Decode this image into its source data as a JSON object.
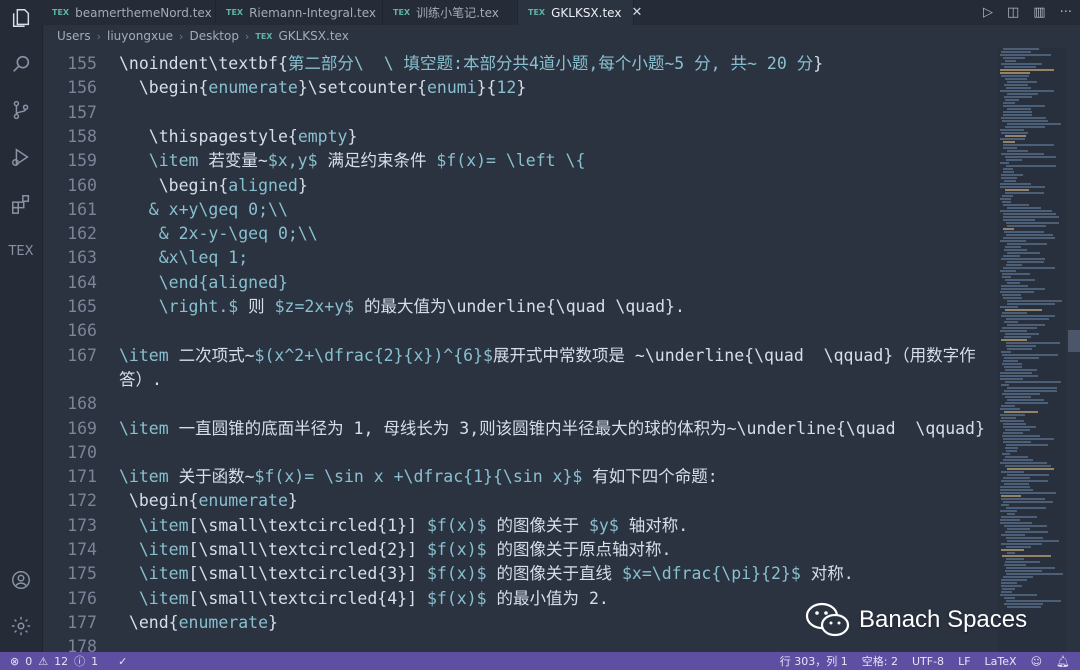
{
  "tabs": [
    {
      "label": "beamerthemeNord.tex",
      "active": false
    },
    {
      "label": "Riemann-Integral.tex",
      "active": false
    },
    {
      "label": "训练小笔记.tex",
      "active": false
    },
    {
      "label": "GKLKSX.tex",
      "active": true
    }
  ],
  "tex_badge": "TEX",
  "activity_tex_label": "TEX",
  "breadcrumb": [
    "Users",
    "liuyongxue",
    "Desktop",
    "GKLKSX.tex"
  ],
  "lines": [
    {
      "num": "155",
      "parts": [
        [
          "\\noindent\\textbf{",
          "cn"
        ],
        [
          "第二部分\\  \\ 填空题:本部分共4道小题,每个小题~5 分, 共~ 20 分",
          "kw"
        ],
        [
          "}",
          "cn"
        ]
      ]
    },
    {
      "num": "156",
      "parts": [
        [
          "  \\begin{",
          "cn"
        ],
        [
          "enumerate",
          "kw"
        ],
        [
          "}\\setcounter{",
          "cn"
        ],
        [
          "enumi",
          "kw"
        ],
        [
          "}{",
          "cn"
        ],
        [
          "12",
          "kw"
        ],
        [
          "}",
          "cn"
        ]
      ]
    },
    {
      "num": "157",
      "parts": [
        [
          "",
          "cn"
        ]
      ]
    },
    {
      "num": "158",
      "parts": [
        [
          "   \\thispagestyle{",
          "cn"
        ],
        [
          "empty",
          "kw"
        ],
        [
          "}",
          "cn"
        ]
      ]
    },
    {
      "num": "159",
      "parts": [
        [
          "   \\item ",
          "kw"
        ],
        [
          "若变量~",
          "cn"
        ],
        [
          "$x,y$",
          "kw"
        ],
        [
          " 满足约束条件 ",
          "cn"
        ],
        [
          "$f(x)= \\left \\{",
          "kw"
        ]
      ]
    },
    {
      "num": "160",
      "parts": [
        [
          "    \\begin{",
          "cn"
        ],
        [
          "aligned",
          "kw"
        ],
        [
          "}",
          "cn"
        ]
      ]
    },
    {
      "num": "161",
      "parts": [
        [
          "   & x+y\\geq 0;\\\\",
          "kw"
        ]
      ]
    },
    {
      "num": "162",
      "parts": [
        [
          "    & 2x-y-\\geq 0;\\\\",
          "kw"
        ]
      ]
    },
    {
      "num": "163",
      "parts": [
        [
          "    &x\\leq 1;",
          "kw"
        ]
      ]
    },
    {
      "num": "164",
      "parts": [
        [
          "    \\end{",
          "kw"
        ],
        [
          "aligned",
          "kw"
        ],
        [
          "}",
          "kw"
        ]
      ]
    },
    {
      "num": "165",
      "parts": [
        [
          "    \\right.$",
          "kw"
        ],
        [
          " 则 ",
          "cn"
        ],
        [
          "$z=2x+y$",
          "kw"
        ],
        [
          " 的最大值为\\underline{\\quad \\quad}.",
          "cn"
        ]
      ]
    },
    {
      "num": "166",
      "parts": [
        [
          "",
          "cn"
        ]
      ]
    },
    {
      "num": "167",
      "parts": [
        [
          "\\item ",
          "kw"
        ],
        [
          "二次项式~",
          "cn"
        ],
        [
          "$(x^2+\\dfrac{2}{x})^{6}$",
          "kw"
        ],
        [
          "展开式中常数项是 ~\\underline{\\quad  \\qquad}（用数字作",
          "cn"
        ]
      ]
    },
    {
      "num": "",
      "parts": [
        [
          "答）.",
          "cn"
        ]
      ]
    },
    {
      "num": "168",
      "parts": [
        [
          "",
          "cn"
        ]
      ]
    },
    {
      "num": "169",
      "parts": [
        [
          "\\item ",
          "kw"
        ],
        [
          "一直圆锥的底面半径为 1, 母线长为 3,则该圆锥内半径最大的球的体积为~\\underline{\\quad  \\qquad}",
          "cn"
        ]
      ]
    },
    {
      "num": "170",
      "parts": [
        [
          "",
          "cn"
        ]
      ]
    },
    {
      "num": "171",
      "parts": [
        [
          "\\item ",
          "kw"
        ],
        [
          "关于函数~",
          "cn"
        ],
        [
          "$f(x)= \\sin x +\\dfrac{1}{\\sin x}$",
          "kw"
        ],
        [
          " 有如下四个命题:",
          "cn"
        ]
      ]
    },
    {
      "num": "172",
      "parts": [
        [
          " \\begin{",
          "cn"
        ],
        [
          "enumerate",
          "kw"
        ],
        [
          "}",
          "cn"
        ]
      ]
    },
    {
      "num": "173",
      "parts": [
        [
          "  \\item",
          "kw"
        ],
        [
          "[\\small\\textcircled{1}] ",
          "cn"
        ],
        [
          "$f(x)$",
          "kw"
        ],
        [
          " 的图像关于 ",
          "cn"
        ],
        [
          "$y$",
          "kw"
        ],
        [
          " 轴对称.",
          "cn"
        ]
      ]
    },
    {
      "num": "174",
      "parts": [
        [
          "  \\item",
          "kw"
        ],
        [
          "[\\small\\textcircled{2}] ",
          "cn"
        ],
        [
          "$f(x)$",
          "kw"
        ],
        [
          " 的图像关于原点轴对称.",
          "cn"
        ]
      ]
    },
    {
      "num": "175",
      "parts": [
        [
          "  \\item",
          "kw"
        ],
        [
          "[\\small\\textcircled{3}] ",
          "cn"
        ],
        [
          "$f(x)$",
          "kw"
        ],
        [
          " 的图像关于直线 ",
          "cn"
        ],
        [
          "$x=\\dfrac{\\pi}{2}$",
          "kw"
        ],
        [
          " 对称.",
          "cn"
        ]
      ]
    },
    {
      "num": "176",
      "parts": [
        [
          "  \\item",
          "kw"
        ],
        [
          "[\\small\\textcircled{4}] ",
          "cn"
        ],
        [
          "$f(x)$",
          "kw"
        ],
        [
          " 的最小值为 2.",
          "cn"
        ]
      ]
    },
    {
      "num": "177",
      "parts": [
        [
          " \\end{",
          "cn"
        ],
        [
          "enumerate",
          "kw"
        ],
        [
          "}",
          "cn"
        ]
      ]
    },
    {
      "num": "178",
      "parts": [
        [
          "",
          "cn"
        ]
      ]
    }
  ],
  "status": {
    "errors": "0",
    "warnings": "12",
    "info": "1",
    "position": "行 303，列 1",
    "indent": "空格: 2",
    "encoding": "UTF-8",
    "eol": "LF",
    "language": "LaTeX"
  },
  "watermark": "Banach Spaces",
  "colors": {
    "accent": "#88c0d0",
    "statusbar": "#5e4fa2",
    "background": "#2b3240"
  }
}
